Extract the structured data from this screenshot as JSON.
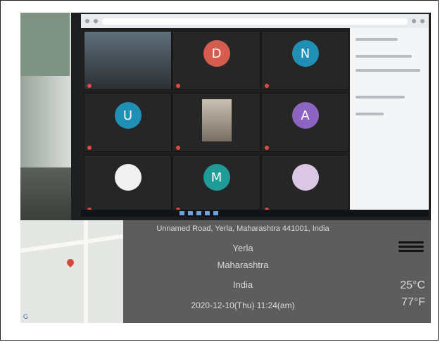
{
  "meeting": {
    "participants": [
      {
        "initial": "D",
        "color": "#d65c4f"
      },
      {
        "initial": "N",
        "color": "#1f8fb5"
      },
      {
        "initial": "U",
        "color": "#1f8fb5"
      },
      {
        "initial": "A",
        "color": "#8e64c2"
      },
      {
        "initial": "M",
        "color": "#1f9c98"
      }
    ]
  },
  "geotag": {
    "address": "Unnamed Road, Yerla, Maharashtra 441001, India",
    "city": "Yerla",
    "state": "Maharashtra",
    "country": "India",
    "datetime": "2020-12-10(Thu) 11:24(am)",
    "temp_c": "25°C",
    "temp_f": "77°F",
    "weather_icon": "haze-icon"
  }
}
